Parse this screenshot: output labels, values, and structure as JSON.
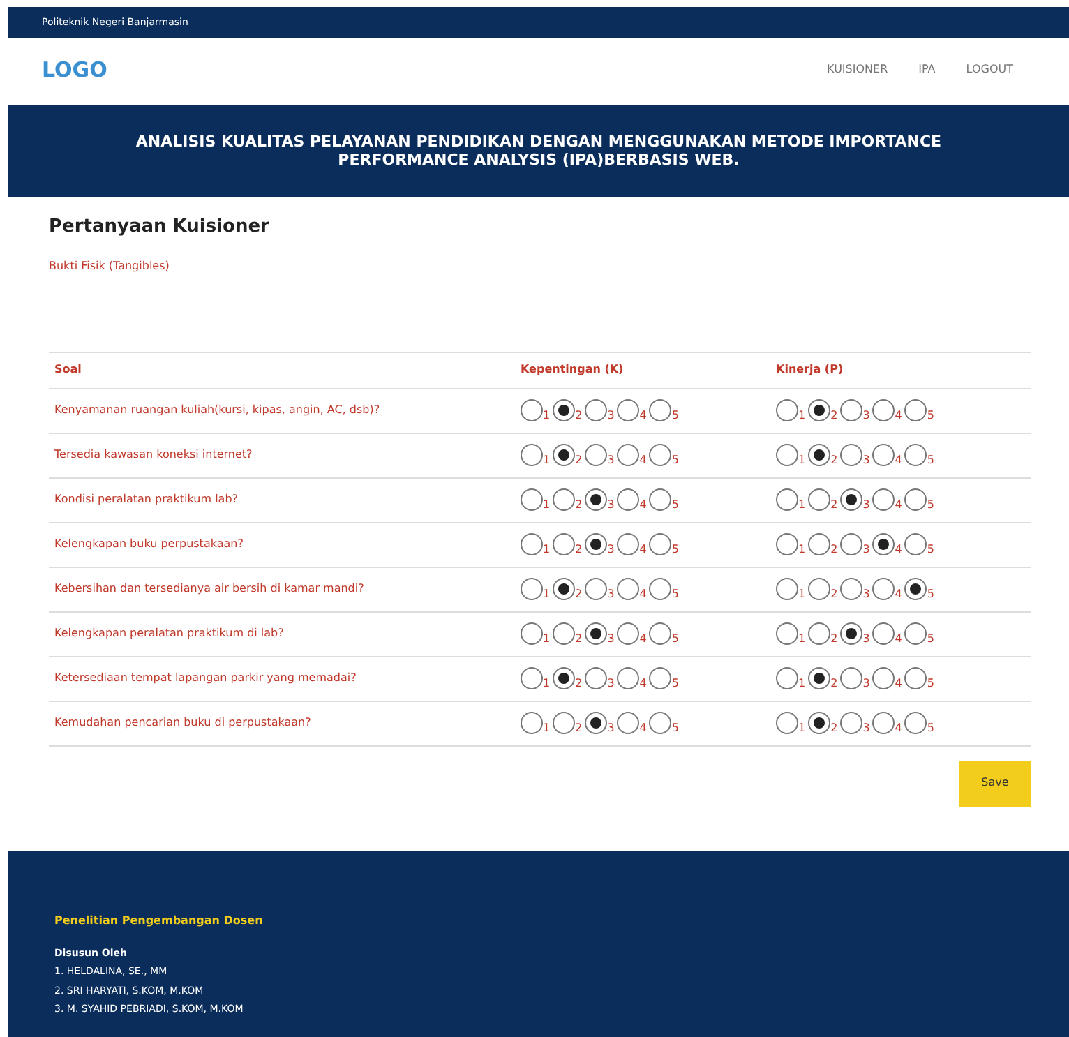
{
  "topbar": {
    "text": "Politeknik Negeri Banjarmasin"
  },
  "nav": {
    "logo": "LOGO",
    "links": [
      "KUISIONER",
      "IPA",
      "LOGOUT"
    ]
  },
  "banner": {
    "title": "ANALISIS KUALITAS PELAYANAN PENDIDIKAN DENGAN MENGGUNAKAN METODE IMPORTANCE PERFORMANCE ANALYSIS (IPA)BERBASIS WEB."
  },
  "heading": "Pertanyaan Kuisioner",
  "category": "Bukti Fisik (Tangibles)",
  "table": {
    "columns": [
      "Soal",
      "Kepentingan (K)",
      "Kinerja (P)"
    ],
    "rows": [
      {
        "question": "Kenyamanan ruangan kuliah(kursi, kipas, angin, AC, dsb)?",
        "importance": [
          {
            "label": "1",
            "selected": false
          },
          {
            "label": "2",
            "selected": true
          },
          {
            "label": "3",
            "selected": false
          },
          {
            "label": "4",
            "selected": false
          },
          {
            "label": "5",
            "selected": false
          }
        ],
        "performance": [
          {
            "label": "1",
            "selected": false
          },
          {
            "label": "2",
            "selected": true
          },
          {
            "label": "3",
            "selected": false
          },
          {
            "label": "4",
            "selected": false
          },
          {
            "label": "5",
            "selected": false
          }
        ]
      },
      {
        "question": "Tersedia kawasan koneksi internet?",
        "importance": [
          {
            "label": "1",
            "selected": false
          },
          {
            "label": "2",
            "selected": true
          },
          {
            "label": "3",
            "selected": false
          },
          {
            "label": "4",
            "selected": false
          },
          {
            "label": "5",
            "selected": false
          }
        ],
        "performance": [
          {
            "label": "1",
            "selected": false
          },
          {
            "label": "2",
            "selected": true
          },
          {
            "label": "3",
            "selected": false
          },
          {
            "label": "4",
            "selected": false
          },
          {
            "label": "5",
            "selected": false
          }
        ]
      },
      {
        "question": "Kondisi peralatan praktikum lab?",
        "importance": [
          {
            "label": "1",
            "selected": false
          },
          {
            "label": "2",
            "selected": false
          },
          {
            "label": "3",
            "selected": true
          },
          {
            "label": "4",
            "selected": false
          },
          {
            "label": "5",
            "selected": false
          }
        ],
        "performance": [
          {
            "label": "1",
            "selected": false
          },
          {
            "label": "2",
            "selected": false
          },
          {
            "label": "3",
            "selected": true
          },
          {
            "label": "4",
            "selected": false
          },
          {
            "label": "5",
            "selected": false
          }
        ]
      },
      {
        "question": "Kelengkapan buku perpustakaan?",
        "importance": [
          {
            "label": "1",
            "selected": false
          },
          {
            "label": "2",
            "selected": false
          },
          {
            "label": "3",
            "selected": true
          },
          {
            "label": "4",
            "selected": false
          },
          {
            "label": "5",
            "selected": false
          }
        ],
        "performance": [
          {
            "label": "1",
            "selected": false
          },
          {
            "label": "2",
            "selected": false
          },
          {
            "label": "3",
            "selected": false
          },
          {
            "label": "4",
            "selected": true
          },
          {
            "label": "5",
            "selected": false
          }
        ]
      },
      {
        "question": "Kebersihan dan tersedianya air bersih di kamar mandi?",
        "importance": [
          {
            "label": "1",
            "selected": false
          },
          {
            "label": "2",
            "selected": true
          },
          {
            "label": "3",
            "selected": false
          },
          {
            "label": "4",
            "selected": false
          },
          {
            "label": "5",
            "selected": false
          }
        ],
        "performance": [
          {
            "label": "1",
            "selected": false
          },
          {
            "label": "2",
            "selected": false
          },
          {
            "label": "3",
            "selected": false
          },
          {
            "label": "4",
            "selected": false
          },
          {
            "label": "5",
            "selected": true
          }
        ]
      },
      {
        "question": "Kelengkapan peralatan praktikum di lab?",
        "importance": [
          {
            "label": "1",
            "selected": false
          },
          {
            "label": "2",
            "selected": false
          },
          {
            "label": "3",
            "selected": true
          },
          {
            "label": "4",
            "selected": false
          },
          {
            "label": "5",
            "selected": false
          }
        ],
        "performance": [
          {
            "label": "1",
            "selected": false
          },
          {
            "label": "2",
            "selected": false
          },
          {
            "label": "3",
            "selected": true
          },
          {
            "label": "4",
            "selected": false
          },
          {
            "label": "5",
            "selected": false
          }
        ]
      },
      {
        "question": "Ketersediaan tempat lapangan parkir yang memadai?",
        "importance": [
          {
            "label": "1",
            "selected": false
          },
          {
            "label": "2",
            "selected": true
          },
          {
            "label": "3",
            "selected": false
          },
          {
            "label": "4",
            "selected": false
          },
          {
            "label": "5",
            "selected": false
          }
        ],
        "performance": [
          {
            "label": "1",
            "selected": false
          },
          {
            "label": "2",
            "selected": true
          },
          {
            "label": "3",
            "selected": false
          },
          {
            "label": "4",
            "selected": false
          },
          {
            "label": "5",
            "selected": false
          }
        ]
      },
      {
        "question": "Kemudahan pencarian buku di perpustakaan?",
        "importance": [
          {
            "label": "1",
            "selected": false
          },
          {
            "label": "2",
            "selected": false
          },
          {
            "label": "3",
            "selected": true
          },
          {
            "label": "4",
            "selected": false
          },
          {
            "label": "5",
            "selected": false
          }
        ],
        "performance": [
          {
            "label": "1",
            "selected": false
          },
          {
            "label": "2",
            "selected": true
          },
          {
            "label": "3",
            "selected": false
          },
          {
            "label": "4",
            "selected": false
          },
          {
            "label": "5",
            "selected": false
          }
        ]
      }
    ]
  },
  "save_button": "Save",
  "footer": {
    "title": "Penelitian Pengembangan Dosen",
    "subtitle": "Disusun Oleh",
    "authors": [
      "1. HELDALINA, SE., MM",
      "2. SRI HARYATI, S.KOM, M.KOM",
      "3. M. SYAHID PEBRIADI, S.KOM, M.KOM"
    ]
  }
}
